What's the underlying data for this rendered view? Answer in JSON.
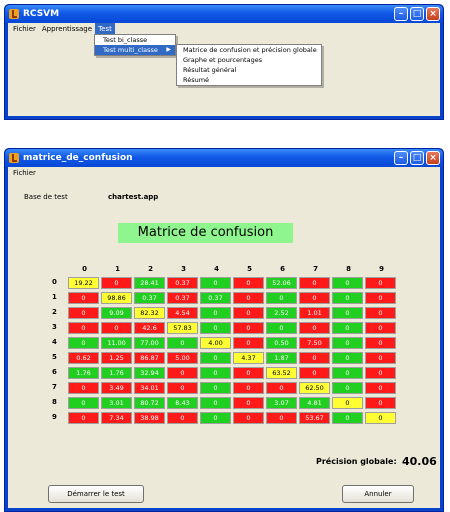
{
  "window1": {
    "title": "RCSVM",
    "menu": [
      "Fichier",
      "Apprentissage",
      "Test"
    ],
    "test_menu": {
      "items": [
        "Test bi_classe",
        "Test multi_classe"
      ]
    },
    "submenu": {
      "items": [
        "Matrice de confusion et précision globale",
        "Graphe et pourcentages",
        "Résultat général",
        "Résumé"
      ]
    }
  },
  "window2": {
    "title": "matrice_de_confusion",
    "menu": [
      "Fichier"
    ],
    "base_label": "Base de test",
    "base_value": "chartest.app",
    "matrix_title": "Matrice de confusion",
    "headers": [
      "0",
      "1",
      "2",
      "3",
      "4",
      "5",
      "6",
      "7",
      "8",
      "9"
    ],
    "rows": [
      [
        "19.22",
        "0",
        "28.41",
        "0.37",
        "0",
        "0",
        "52.06",
        "0",
        "0",
        "0"
      ],
      [
        "0",
        "98.86",
        "0.37",
        "0.37",
        "0.37",
        "0",
        "0",
        "0",
        "0",
        "0"
      ],
      [
        "0",
        "9.09",
        "82.32",
        "4.54",
        "0",
        "0",
        "2.52",
        "1.01",
        "0",
        "0"
      ],
      [
        "0",
        "0",
        "42.6",
        "57.83",
        "0",
        "0",
        "0",
        "0",
        "0",
        "0"
      ],
      [
        "0",
        "11.00",
        "77.00",
        "0",
        "4.00",
        "0",
        "0.50",
        "7.50",
        "0",
        "0"
      ],
      [
        "0.62",
        "1.25",
        "86.87",
        "5.00",
        "0",
        "4.37",
        "1.87",
        "0",
        "0",
        "0"
      ],
      [
        "1.76",
        "1.76",
        "32.94",
        "0",
        "0",
        "0",
        "63.52",
        "0",
        "0",
        "0"
      ],
      [
        "0",
        "3.49",
        "34.01",
        "0",
        "0",
        "0",
        "0",
        "62.50",
        "0",
        "0"
      ],
      [
        "0",
        "3.01",
        "80.72",
        "8.43",
        "0",
        "0",
        "3.07",
        "4.81",
        "0",
        "0"
      ],
      [
        "0",
        "7.34",
        "38.98",
        "0",
        "0",
        "0",
        "0",
        "53.67",
        "0",
        "0"
      ]
    ],
    "colors": [
      [
        "yellow",
        "red",
        "green",
        "red",
        "green",
        "red",
        "green",
        "red",
        "green",
        "red"
      ],
      [
        "red",
        "yellow",
        "green",
        "red",
        "green",
        "red",
        "green",
        "red",
        "green",
        "red"
      ],
      [
        "red",
        "green",
        "yellow",
        "red",
        "green",
        "red",
        "green",
        "red",
        "green",
        "red"
      ],
      [
        "red",
        "red",
        "red",
        "yellow",
        "green",
        "red",
        "green",
        "red",
        "green",
        "red"
      ],
      [
        "green",
        "green",
        "green",
        "green",
        "yellow",
        "red",
        "green",
        "red",
        "green",
        "red"
      ],
      [
        "red",
        "red",
        "red",
        "red",
        "green",
        "yellow",
        "green",
        "red",
        "green",
        "red"
      ],
      [
        "green",
        "green",
        "green",
        "red",
        "green",
        "red",
        "yellow",
        "red",
        "green",
        "red"
      ],
      [
        "red",
        "red",
        "red",
        "red",
        "green",
        "red",
        "red",
        "yellow",
        "green",
        "red"
      ],
      [
        "green",
        "green",
        "green",
        "green",
        "green",
        "red",
        "green",
        "green",
        "yellow",
        "red"
      ],
      [
        "red",
        "red",
        "red",
        "red",
        "green",
        "red",
        "red",
        "red",
        "green",
        "yellow"
      ]
    ],
    "precision_label": "Précision globale:",
    "precision_value": "40.06",
    "buttons": {
      "start": "Démarrer le test",
      "cancel": "Annuler"
    }
  }
}
